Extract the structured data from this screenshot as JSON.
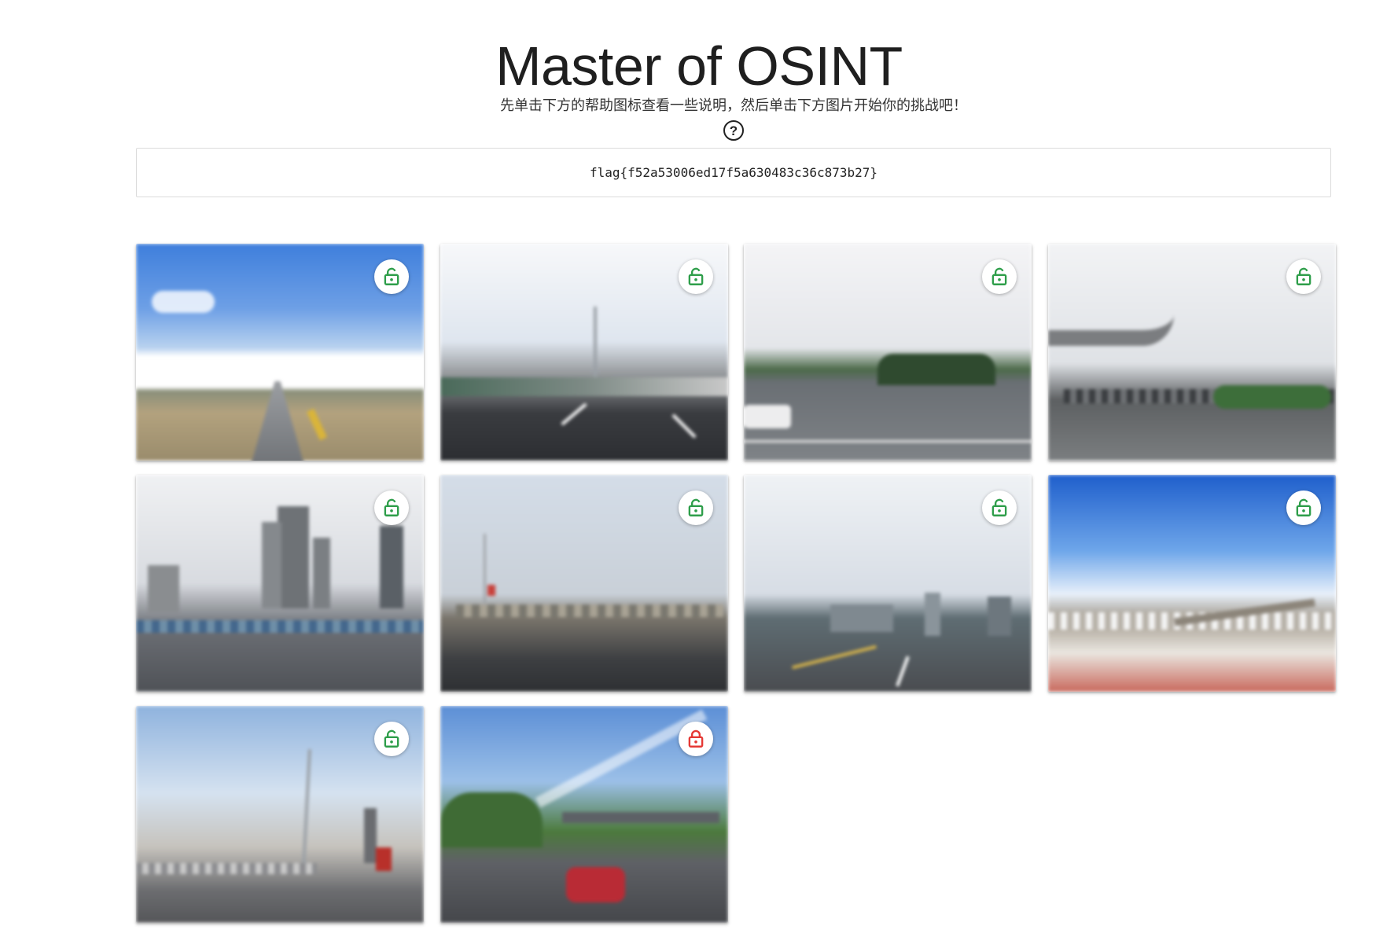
{
  "header": {
    "title": "Master of OSINT",
    "subtitle": "先单击下方的帮助图标查看一些说明，然后单击下方图片开始你的挑战吧！",
    "help_glyph": "?"
  },
  "flag": {
    "value": "flag{f52a53006ed17f5a630483c36c873b27}"
  },
  "colors": {
    "unlocked": "#2e9e4a",
    "locked": "#e53935"
  },
  "challenges": [
    {
      "name": "challenge-1",
      "status": "unlocked",
      "icon": "lock-open-icon",
      "scene": "open-field-road"
    },
    {
      "name": "challenge-2",
      "status": "unlocked",
      "icon": "lock-open-icon",
      "scene": "highway-overpass"
    },
    {
      "name": "challenge-3",
      "status": "unlocked",
      "icon": "lock-open-icon",
      "scene": "road-intersection"
    },
    {
      "name": "challenge-4",
      "status": "unlocked",
      "icon": "lock-open-icon",
      "scene": "elevated-bridge"
    },
    {
      "name": "challenge-5",
      "status": "unlocked",
      "icon": "lock-open-icon",
      "scene": "city-highrises"
    },
    {
      "name": "challenge-6",
      "status": "unlocked",
      "icon": "lock-open-icon",
      "scene": "bridge-deck"
    },
    {
      "name": "challenge-7",
      "status": "unlocked",
      "icon": "lock-open-icon",
      "scene": "city-skyline-road"
    },
    {
      "name": "challenge-8",
      "status": "unlocked",
      "icon": "lock-open-icon",
      "scene": "river-railing"
    },
    {
      "name": "challenge-9",
      "status": "unlocked",
      "icon": "lock-open-icon",
      "scene": "cable-bridge"
    },
    {
      "name": "challenge-10",
      "status": "locked",
      "icon": "lock-closed-icon",
      "scene": "street-red-car"
    }
  ]
}
